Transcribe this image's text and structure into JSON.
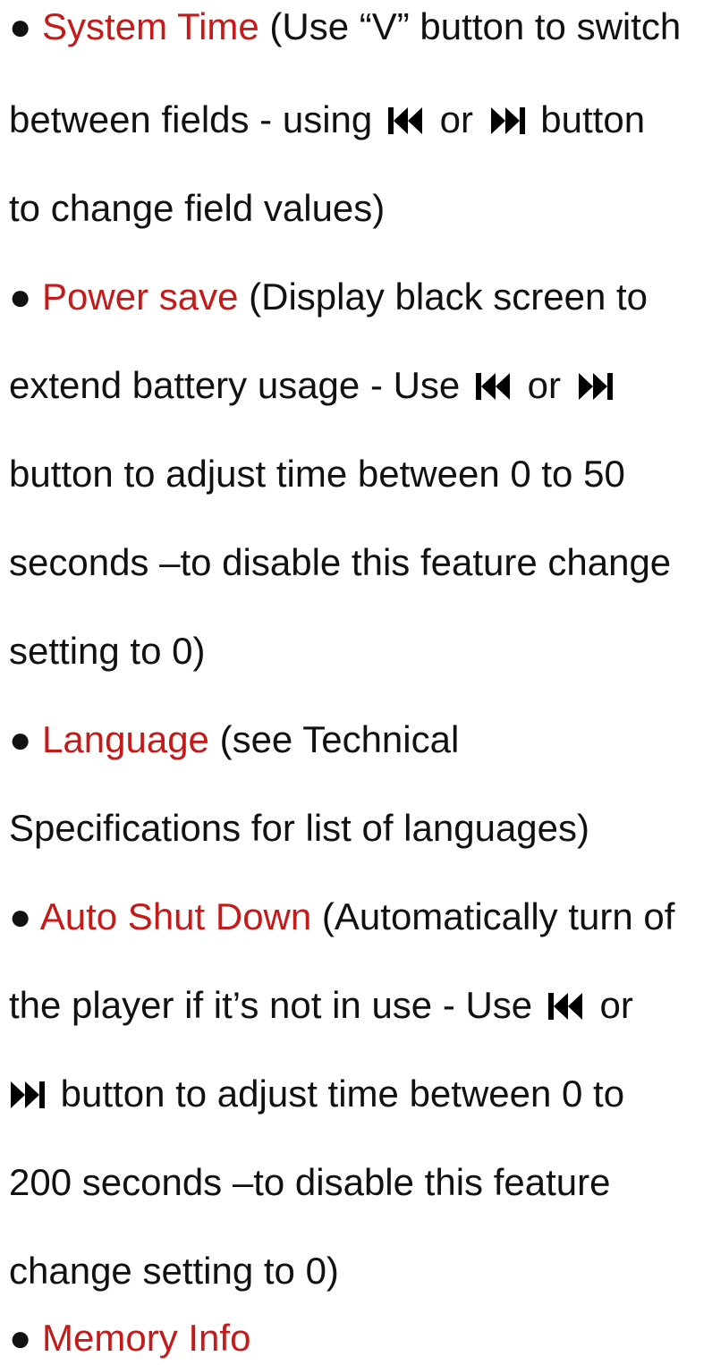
{
  "bullet_glyph": "●",
  "term_color": "#c41a1a",
  "text_color": "#111111",
  "icons": {
    "prev": "skip-previous-icon",
    "next": "skip-next-icon"
  },
  "items": {
    "system_time": {
      "term": "System Time",
      "l1": " (Use “V” button to switch",
      "l2a": "between fields - using",
      "l2b": "or",
      "l2c": "button",
      "l3": "to change field values)"
    },
    "power_save": {
      "term": "Power save",
      "l1": " (Display black screen to",
      "l2a": "extend battery usage - Use",
      "l2b": "or",
      "l3": "button to adjust time between 0 to 50",
      "l4": "seconds –to disable this feature change",
      "l5": "setting to 0)"
    },
    "language": {
      "term": "Language",
      "l1": " (see Technical",
      "l2": "Specifications for list of languages)"
    },
    "auto_shut_down": {
      "term": "Auto Shut Down",
      "l1": " (Automatically turn of",
      "l2a": "the player if it’s not in use - Use",
      "l2b": "or",
      "l3": "button to adjust time between 0 to",
      "l4": "200 seconds –to disable this feature",
      "l5": "change setting to 0)"
    },
    "memory_info": {
      "term": "Memory Info"
    }
  }
}
